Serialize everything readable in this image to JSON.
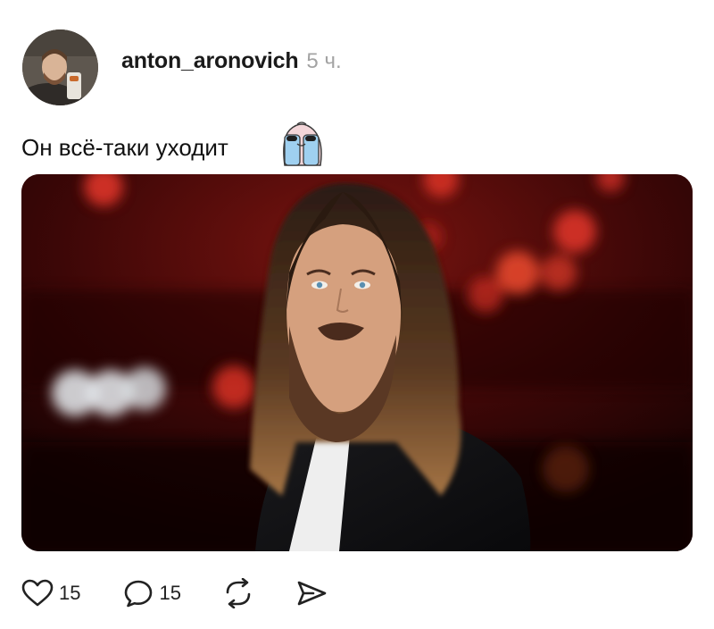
{
  "post": {
    "author": {
      "username": "anton_aronovich",
      "time": "5 ч."
    },
    "text": "Он всё-таки уходит",
    "stats": {
      "likes": "15",
      "comments": "15"
    },
    "icons": {
      "like": "heart-icon",
      "comment": "comment-bubble-icon",
      "repost": "repost-icon",
      "share": "send-icon",
      "sticker": "crying-sticker"
    }
  }
}
